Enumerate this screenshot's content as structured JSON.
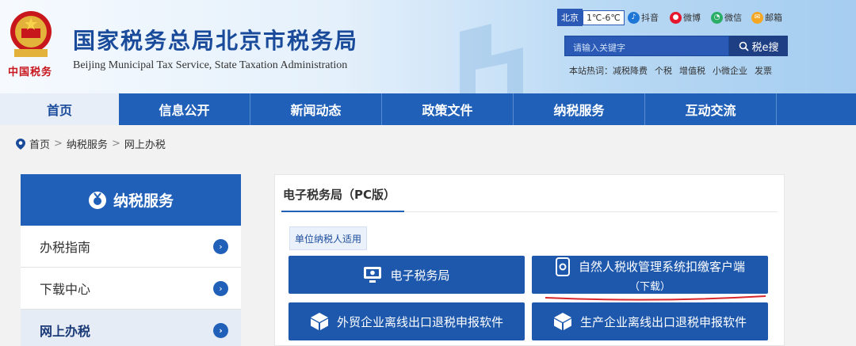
{
  "header": {
    "emblem_text": "中国税务",
    "title": "国家税务总局北京市税务局",
    "subtitle": "Beijing Municipal Tax Service, State Taxation Administration",
    "weather": {
      "city": "北京",
      "temp": "1℃-6℃"
    },
    "social": [
      {
        "label": "抖音",
        "icon": "tiktok-icon",
        "color": "#1e76d6"
      },
      {
        "label": "微博",
        "icon": "weibo-icon",
        "color": "#e6162d"
      },
      {
        "label": "微信",
        "icon": "wechat-icon",
        "color": "#2aae67"
      },
      {
        "label": "邮箱",
        "icon": "mail-icon",
        "color": "#f5a623"
      }
    ],
    "search": {
      "placeholder": "请输入关键字",
      "button": "税e搜"
    },
    "hot": {
      "label": "本站热词：",
      "items": [
        "减税降费",
        "个税",
        "增值税",
        "小微企业",
        "发票"
      ]
    }
  },
  "nav": {
    "items": [
      "首页",
      "信息公开",
      "新闻动态",
      "政策文件",
      "纳税服务",
      "互动交流"
    ]
  },
  "breadcrumb": {
    "items": [
      "首页",
      "纳税服务",
      "网上办税"
    ],
    "separator": ">"
  },
  "sidebar": {
    "title": "纳税服务",
    "items": [
      {
        "label": "办税指南",
        "active": false
      },
      {
        "label": "下载中心",
        "active": false
      },
      {
        "label": "网上办税",
        "active": true
      }
    ]
  },
  "panel": {
    "title": "电子税务局（PC版）",
    "tag": "单位纳税人适用",
    "tiles": {
      "etax": "电子税务局",
      "natural": "自然人税收管理系统扣缴客户端",
      "natural_sub": "（下载）",
      "foreign_trade": "外贸企业离线出口退税申报软件",
      "production": "生产企业离线出口退税申报软件"
    }
  },
  "colors": {
    "brand": "#2160b8",
    "title": "#1a4b9b",
    "tile": "#1d58ad",
    "annotation": "#d9262a"
  }
}
